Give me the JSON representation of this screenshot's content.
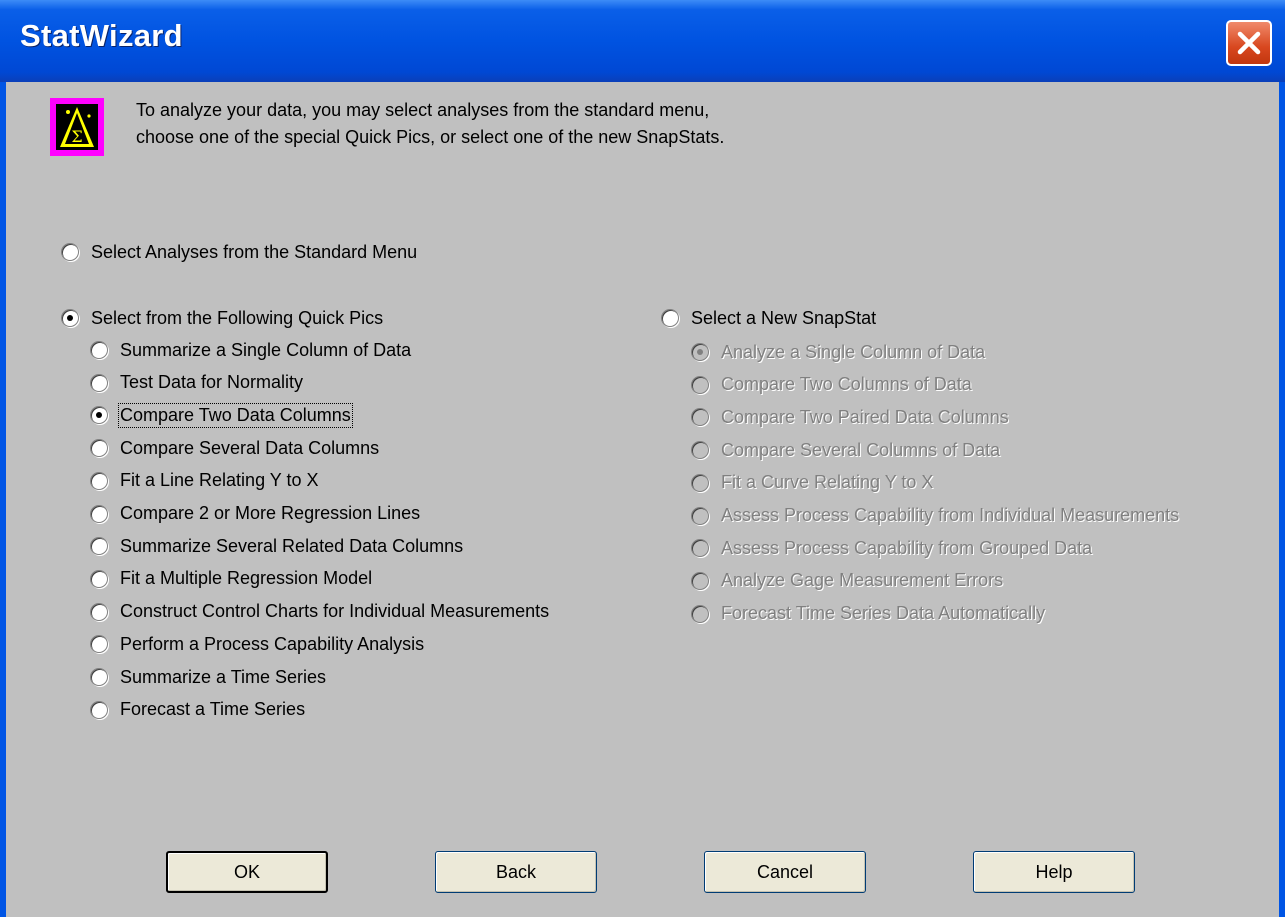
{
  "window": {
    "title": "StatWizard"
  },
  "intro": {
    "line1": "To analyze your data, you may select analyses from the standard menu,",
    "line2": "choose one of the special Quick Pics, or select one of the new SnapStats."
  },
  "standard_menu": {
    "label": "Select Analyses from the Standard Menu",
    "selected": false
  },
  "quick_pics": {
    "label": "Select from the Following Quick Pics",
    "selected": true,
    "items": [
      {
        "label": "Summarize a Single Column of Data",
        "selected": false
      },
      {
        "label": "Test Data for Normality",
        "selected": false
      },
      {
        "label": "Compare Two Data Columns",
        "selected": true
      },
      {
        "label": "Compare Several Data Columns",
        "selected": false
      },
      {
        "label": "Fit a Line Relating Y to X",
        "selected": false
      },
      {
        "label": "Compare 2 or More Regression Lines",
        "selected": false
      },
      {
        "label": "Summarize Several Related Data Columns",
        "selected": false
      },
      {
        "label": "Fit a Multiple Regression Model",
        "selected": false
      },
      {
        "label": "Construct Control Charts for Individual Measurements",
        "selected": false
      },
      {
        "label": "Perform a Process Capability Analysis",
        "selected": false
      },
      {
        "label": "Summarize a Time Series",
        "selected": false
      },
      {
        "label": "Forecast a Time Series",
        "selected": false
      }
    ]
  },
  "snapstat": {
    "label": "Select a New SnapStat",
    "selected": false,
    "items": [
      {
        "label": "Analyze a Single Column of Data",
        "selected": true
      },
      {
        "label": "Compare Two Columns of Data",
        "selected": false
      },
      {
        "label": "Compare Two Paired Data Columns",
        "selected": false
      },
      {
        "label": "Compare Several Columns of Data",
        "selected": false
      },
      {
        "label": "Fit a Curve Relating Y to X",
        "selected": false
      },
      {
        "label": "Assess Process Capability from Individual Measurements",
        "selected": false
      },
      {
        "label": "Assess Process Capability from Grouped Data",
        "selected": false
      },
      {
        "label": "Analyze Gage Measurement Errors",
        "selected": false
      },
      {
        "label": "Forecast Time Series Data Automatically",
        "selected": false
      }
    ]
  },
  "buttons": {
    "ok": "OK",
    "back": "Back",
    "cancel": "Cancel",
    "help": "Help"
  }
}
